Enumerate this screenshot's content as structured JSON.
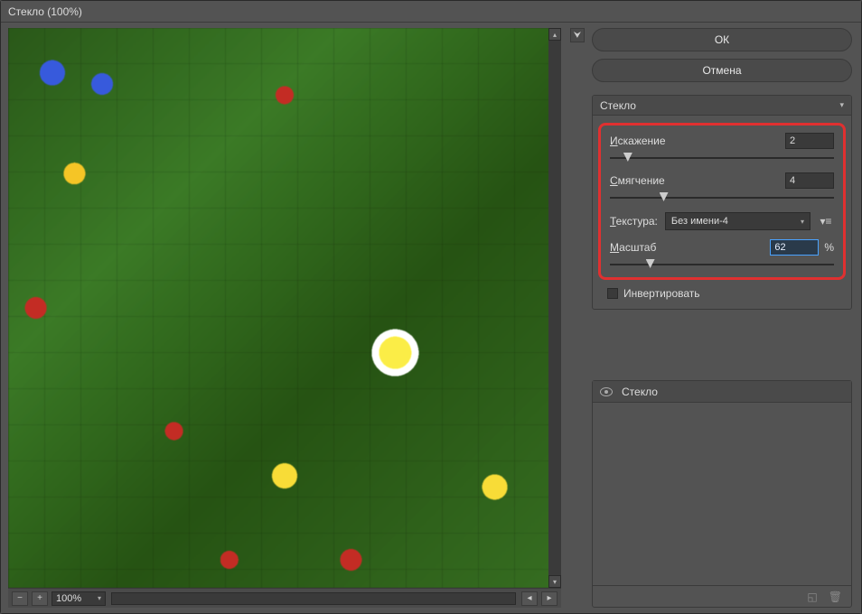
{
  "title": "Стекло (100%)",
  "preview": {
    "zoom": "100%"
  },
  "buttons": {
    "ok": "ОК",
    "cancel": "Отмена"
  },
  "filter": {
    "name": "Стекло",
    "params": {
      "distortion": {
        "label_prefix": "И",
        "label_rest": "скажение",
        "value": "2",
        "thumb_pct": 8
      },
      "smoothness": {
        "label_prefix": "С",
        "label_rest": "мягчение",
        "value": "4",
        "thumb_pct": 24
      },
      "texture": {
        "label_prefix": "Т",
        "label_rest": "екстура:",
        "selected": "Без имени-4"
      },
      "scale": {
        "label_prefix": "М",
        "label_rest": "асштаб",
        "value": "62",
        "unit": "%",
        "thumb_pct": 18
      }
    },
    "invert": {
      "label": "Инвертировать",
      "checked": false
    }
  },
  "layers": {
    "items": [
      {
        "name": "Стекло",
        "visible": true
      }
    ]
  },
  "icons": {
    "chevron_down": "▾",
    "chevron_up": "▴",
    "chevron_left": "◂",
    "chevron_right": "▸",
    "collapse": "⮟",
    "fit": "⊞",
    "grid": "▦",
    "menu": "▾≡",
    "new_layer": "◱",
    "trash": "🗑"
  }
}
